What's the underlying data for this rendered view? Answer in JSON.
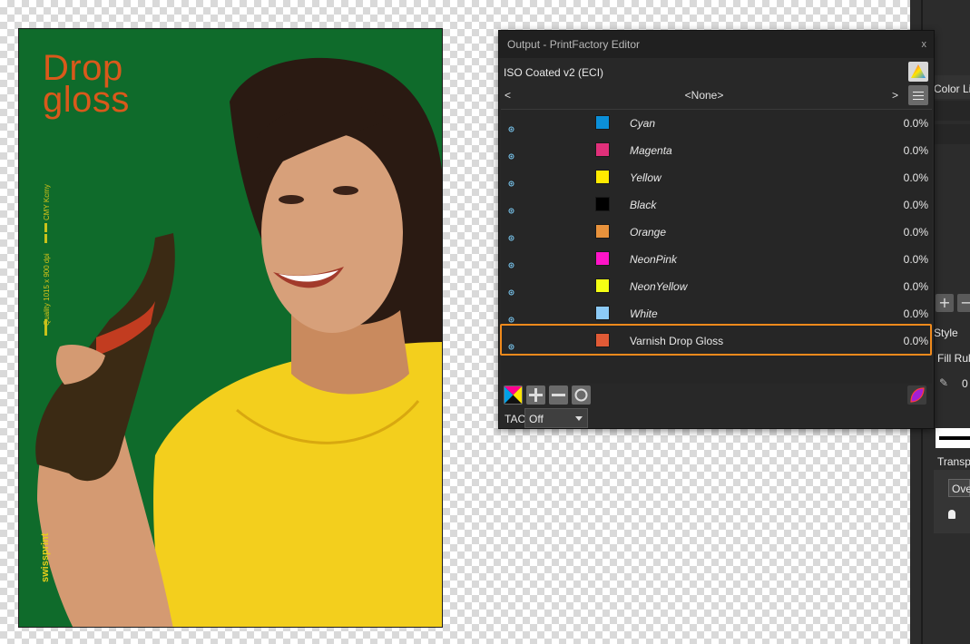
{
  "artwork": {
    "title_line1": "Drop",
    "title_line2": "gloss",
    "vertical_label_1": "CMY Kcmy",
    "vertical_label_2": "Quality 1015 x 900 dpi",
    "brand": "swissprint",
    "colors": {
      "background": "#0f6b2b",
      "title": "#d9591b",
      "shirt": "#f3cf1d"
    }
  },
  "panel": {
    "title": "Output - PrintFactory Editor",
    "close_glyph": "x",
    "profile": "ISO Coated v2 (ECI)",
    "nav": {
      "prev": "<",
      "value": "<None>",
      "next": ">"
    },
    "separations": [
      {
        "name": "Cyan",
        "color": "#0b8fd8",
        "value": "0.0%"
      },
      {
        "name": "Magenta",
        "color": "#e0307a",
        "value": "0.0%"
      },
      {
        "name": "Yellow",
        "color": "#ffea00",
        "value": "0.0%"
      },
      {
        "name": "Black",
        "color": "#000000",
        "value": "0.0%"
      },
      {
        "name": "Orange",
        "color": "#e8923c",
        "value": "0.0%"
      },
      {
        "name": "NeonPink",
        "color": "#ff14c8",
        "value": "0.0%"
      },
      {
        "name": "NeonYellow",
        "color": "#f4ff14",
        "value": "0.0%"
      },
      {
        "name": "White",
        "color": "#8ccaf6",
        "value": "0.0%"
      },
      {
        "name": "Varnish Drop Gloss",
        "color": "#e05a36",
        "value": "0.0%"
      }
    ],
    "highlight_color": "#f08a1c",
    "tac_label": "TAC",
    "tac_value": "Off"
  },
  "dock": {
    "color_label": "Color Li",
    "style_label": "Style",
    "fill_label": "Fill Rul",
    "value_0": "0",
    "transparency_label": "Transpa",
    "blend_label": "Ove"
  }
}
